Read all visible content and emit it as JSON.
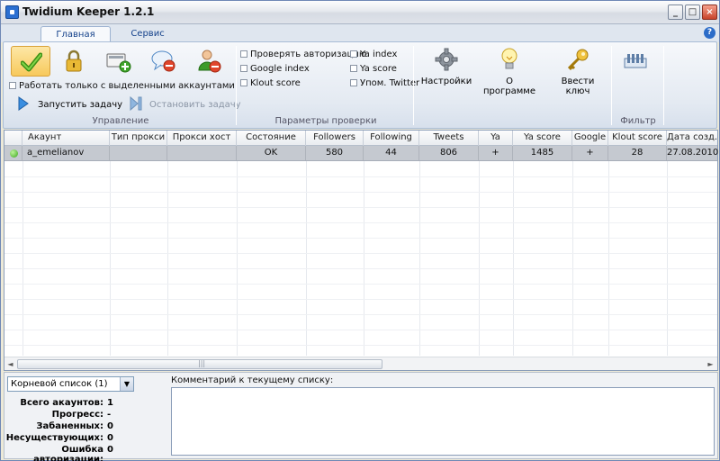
{
  "window": {
    "title": "Twidium Keeper 1.2.1"
  },
  "ribbon": {
    "tabs": [
      "Главная",
      "Сервис"
    ],
    "groups": {
      "control": {
        "label": "Управление",
        "only_selected_label": "Работать только с выделенными аккаунтами",
        "start_label": "Запустить задачу",
        "stop_label": "Остановить задачу"
      },
      "params": {
        "label": "Параметры проверки",
        "checks_left": [
          "Проверять авторизацию",
          "Google index",
          "Klout score"
        ],
        "checks_right": [
          "Ya index",
          "Ya score",
          "Упом. Twitter"
        ]
      },
      "tools": {
        "settings": "Настройки",
        "about": "О программе",
        "enter_key": "Ввести ключ"
      },
      "filter": {
        "label": "Фильтр"
      }
    },
    "icons": {
      "check": "check-icon",
      "lock": "lock-icon",
      "add_card": "add-account-icon",
      "comment_remove": "comment-remove-icon",
      "user_remove": "user-remove-icon",
      "play": "play-icon",
      "stop": "stop-icon",
      "gear": "gear-icon",
      "bulb": "lightbulb-icon",
      "key": "key-icon",
      "filter": "filter-icon"
    }
  },
  "grid": {
    "columns": [
      "Акаунт",
      "Тип прокси",
      "Прокси хост",
      "Состояние",
      "Followers",
      "Following",
      "Tweets",
      "Ya",
      "Ya score",
      "Google",
      "Klout score",
      "Дата созд."
    ],
    "rows": [
      {
        "account": "a_emelianov",
        "proxy_type": "",
        "proxy_host": "",
        "state": "OK",
        "followers": "580",
        "following": "44",
        "tweets": "806",
        "ya": "+",
        "ya_score": "1485",
        "google": "+",
        "klout": "28",
        "created": "27.08.2010"
      }
    ],
    "scroll_grip": "|||"
  },
  "bottom": {
    "list_select": "Корневой список (1)",
    "stats": [
      {
        "label": "Всего акаунтов:",
        "value": "1"
      },
      {
        "label": "Прогресс:",
        "value": "-"
      },
      {
        "label": "Забаненных:",
        "value": "0"
      },
      {
        "label": "Несуществующих:",
        "value": "0"
      },
      {
        "label": "Ошибка авторизации:",
        "value": "0"
      }
    ],
    "comment_label": "Комментарий к текущему списку:"
  }
}
